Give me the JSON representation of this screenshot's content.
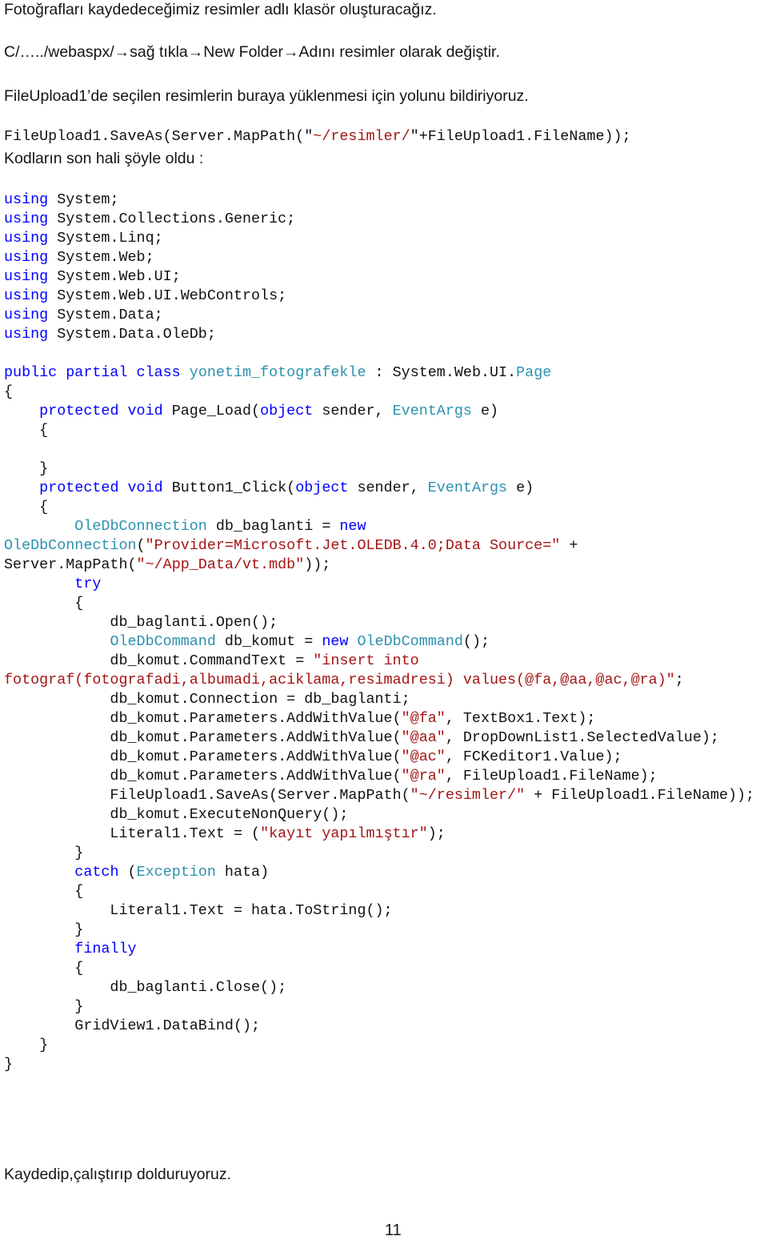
{
  "intro": {
    "line1": "Fotoğrafları kaydedeceğimiz resimler adlı klasör oluşturacağız.",
    "line2": "C/…../webaspx/→sağ tıkla→New Folder→Adını resimler olarak değiştir.",
    "line3": "FileUpload1’de seçilen resimlerin buraya yüklenmesi için yolunu bildiriyoruz.",
    "snippet": [
      {
        "t": "FileUpload1.SaveAs(Server.MapPath(\"",
        "c": "pl"
      },
      {
        "t": "~/resimler/",
        "c": "st"
      },
      {
        "t": "\"+FileUpload1.FileName));",
        "c": "pl"
      }
    ],
    "line4": "Kodların son hali şöyle oldu :"
  },
  "code_lines": [
    [
      {
        "t": "using",
        "c": "kw"
      },
      {
        "t": " System;",
        "c": "pl"
      }
    ],
    [
      {
        "t": "using",
        "c": "kw"
      },
      {
        "t": " System.Collections.Generic;",
        "c": "pl"
      }
    ],
    [
      {
        "t": "using",
        "c": "kw"
      },
      {
        "t": " System.Linq;",
        "c": "pl"
      }
    ],
    [
      {
        "t": "using",
        "c": "kw"
      },
      {
        "t": " System.Web;",
        "c": "pl"
      }
    ],
    [
      {
        "t": "using",
        "c": "kw"
      },
      {
        "t": " System.Web.UI;",
        "c": "pl"
      }
    ],
    [
      {
        "t": "using",
        "c": "kw"
      },
      {
        "t": " System.Web.UI.WebControls;",
        "c": "pl"
      }
    ],
    [
      {
        "t": "using",
        "c": "kw"
      },
      {
        "t": " System.Data;",
        "c": "pl"
      }
    ],
    [
      {
        "t": "using",
        "c": "kw"
      },
      {
        "t": " System.Data.OleDb;",
        "c": "pl"
      }
    ],
    [],
    [
      {
        "t": "public partial class",
        "c": "kw"
      },
      {
        "t": " ",
        "c": "pl"
      },
      {
        "t": "yonetim_fotografekle",
        "c": "ty"
      },
      {
        "t": " : System.Web.UI.",
        "c": "pl"
      },
      {
        "t": "Page",
        "c": "ty"
      }
    ],
    [
      {
        "t": "{",
        "c": "pl"
      }
    ],
    [
      {
        "t": "    ",
        "c": "pl"
      },
      {
        "t": "protected void",
        "c": "kw"
      },
      {
        "t": " Page_Load(",
        "c": "pl"
      },
      {
        "t": "object",
        "c": "kw"
      },
      {
        "t": " sender, ",
        "c": "pl"
      },
      {
        "t": "EventArgs",
        "c": "ty"
      },
      {
        "t": " e)",
        "c": "pl"
      }
    ],
    [
      {
        "t": "    {",
        "c": "pl"
      }
    ],
    [],
    [
      {
        "t": "    }",
        "c": "pl"
      }
    ],
    [
      {
        "t": "    ",
        "c": "pl"
      },
      {
        "t": "protected void",
        "c": "kw"
      },
      {
        "t": " Button1_Click(",
        "c": "pl"
      },
      {
        "t": "object",
        "c": "kw"
      },
      {
        "t": " sender, ",
        "c": "pl"
      },
      {
        "t": "EventArgs",
        "c": "ty"
      },
      {
        "t": " e)",
        "c": "pl"
      }
    ],
    [
      {
        "t": "    {",
        "c": "pl"
      }
    ],
    [
      {
        "t": "        ",
        "c": "pl"
      },
      {
        "t": "OleDbConnection",
        "c": "ty"
      },
      {
        "t": " db_baglanti = ",
        "c": "pl"
      },
      {
        "t": "new",
        "c": "kw"
      }
    ],
    [
      {
        "t": "OleDbConnection",
        "c": "ty"
      },
      {
        "t": "(",
        "c": "pl"
      },
      {
        "t": "\"Provider=Microsoft.Jet.OLEDB.4.0;Data Source=\"",
        "c": "st"
      },
      {
        "t": " +",
        "c": "pl"
      }
    ],
    [
      {
        "t": "Server.MapPath(",
        "c": "pl"
      },
      {
        "t": "\"~/App_Data/vt.mdb\"",
        "c": "st"
      },
      {
        "t": "));",
        "c": "pl"
      }
    ],
    [
      {
        "t": "        ",
        "c": "pl"
      },
      {
        "t": "try",
        "c": "kw"
      }
    ],
    [
      {
        "t": "        {",
        "c": "pl"
      }
    ],
    [
      {
        "t": "            db_baglanti.Open();",
        "c": "pl"
      }
    ],
    [
      {
        "t": "            ",
        "c": "pl"
      },
      {
        "t": "OleDbCommand",
        "c": "ty"
      },
      {
        "t": " db_komut = ",
        "c": "pl"
      },
      {
        "t": "new",
        "c": "kw"
      },
      {
        "t": " ",
        "c": "pl"
      },
      {
        "t": "OleDbCommand",
        "c": "ty"
      },
      {
        "t": "();",
        "c": "pl"
      }
    ],
    [
      {
        "t": "            db_komut.CommandText = ",
        "c": "pl"
      },
      {
        "t": "\"insert into",
        "c": "st"
      }
    ],
    [
      {
        "t": "fotograf(fotografadi,albumadi,aciklama,resimadresi) values(@fa,@aa,@ac,@ra)\"",
        "c": "st"
      },
      {
        "t": ";",
        "c": "pl"
      }
    ],
    [
      {
        "t": "            db_komut.Connection = db_baglanti;",
        "c": "pl"
      }
    ],
    [
      {
        "t": "            db_komut.Parameters.AddWithValue(",
        "c": "pl"
      },
      {
        "t": "\"@fa\"",
        "c": "st"
      },
      {
        "t": ", TextBox1.Text);",
        "c": "pl"
      }
    ],
    [
      {
        "t": "            db_komut.Parameters.AddWithValue(",
        "c": "pl"
      },
      {
        "t": "\"@aa\"",
        "c": "st"
      },
      {
        "t": ", DropDownList1.SelectedValue);",
        "c": "pl"
      }
    ],
    [
      {
        "t": "            db_komut.Parameters.AddWithValue(",
        "c": "pl"
      },
      {
        "t": "\"@ac\"",
        "c": "st"
      },
      {
        "t": ", FCKeditor1.Value);",
        "c": "pl"
      }
    ],
    [
      {
        "t": "            db_komut.Parameters.AddWithValue(",
        "c": "pl"
      },
      {
        "t": "\"@ra\"",
        "c": "st"
      },
      {
        "t": ", FileUpload1.FileName);",
        "c": "pl"
      }
    ],
    [
      {
        "t": "            FileUpload1.SaveAs(Server.MapPath(",
        "c": "pl"
      },
      {
        "t": "\"~/resimler/\"",
        "c": "st"
      },
      {
        "t": " + FileUpload1.FileName));",
        "c": "pl"
      }
    ],
    [
      {
        "t": "            db_komut.ExecuteNonQuery();",
        "c": "pl"
      }
    ],
    [
      {
        "t": "            Literal1.Text = (",
        "c": "pl"
      },
      {
        "t": "\"kayıt yapılmıştır\"",
        "c": "st"
      },
      {
        "t": ");",
        "c": "pl"
      }
    ],
    [
      {
        "t": "        }",
        "c": "pl"
      }
    ],
    [
      {
        "t": "        ",
        "c": "pl"
      },
      {
        "t": "catch",
        "c": "kw"
      },
      {
        "t": " (",
        "c": "pl"
      },
      {
        "t": "Exception",
        "c": "ty"
      },
      {
        "t": " hata)",
        "c": "pl"
      }
    ],
    [
      {
        "t": "        {",
        "c": "pl"
      }
    ],
    [
      {
        "t": "            Literal1.Text = hata.ToString();",
        "c": "pl"
      }
    ],
    [
      {
        "t": "        }",
        "c": "pl"
      }
    ],
    [
      {
        "t": "        ",
        "c": "pl"
      },
      {
        "t": "finally",
        "c": "kw"
      }
    ],
    [
      {
        "t": "        {",
        "c": "pl"
      }
    ],
    [
      {
        "t": "            db_baglanti.Close();",
        "c": "pl"
      }
    ],
    [
      {
        "t": "        }",
        "c": "pl"
      }
    ],
    [
      {
        "t": "        GridView1.DataBind();",
        "c": "pl"
      }
    ],
    [
      {
        "t": "    }",
        "c": "pl"
      }
    ],
    [
      {
        "t": "}",
        "c": "pl"
      }
    ]
  ],
  "outro": "Kaydedip,çalıştırıp dolduruyoruz.",
  "page_number": "11",
  "colors": {
    "keyword": "#0000ff",
    "type": "#2b91af",
    "string": "#a31515",
    "text": "#111111"
  }
}
